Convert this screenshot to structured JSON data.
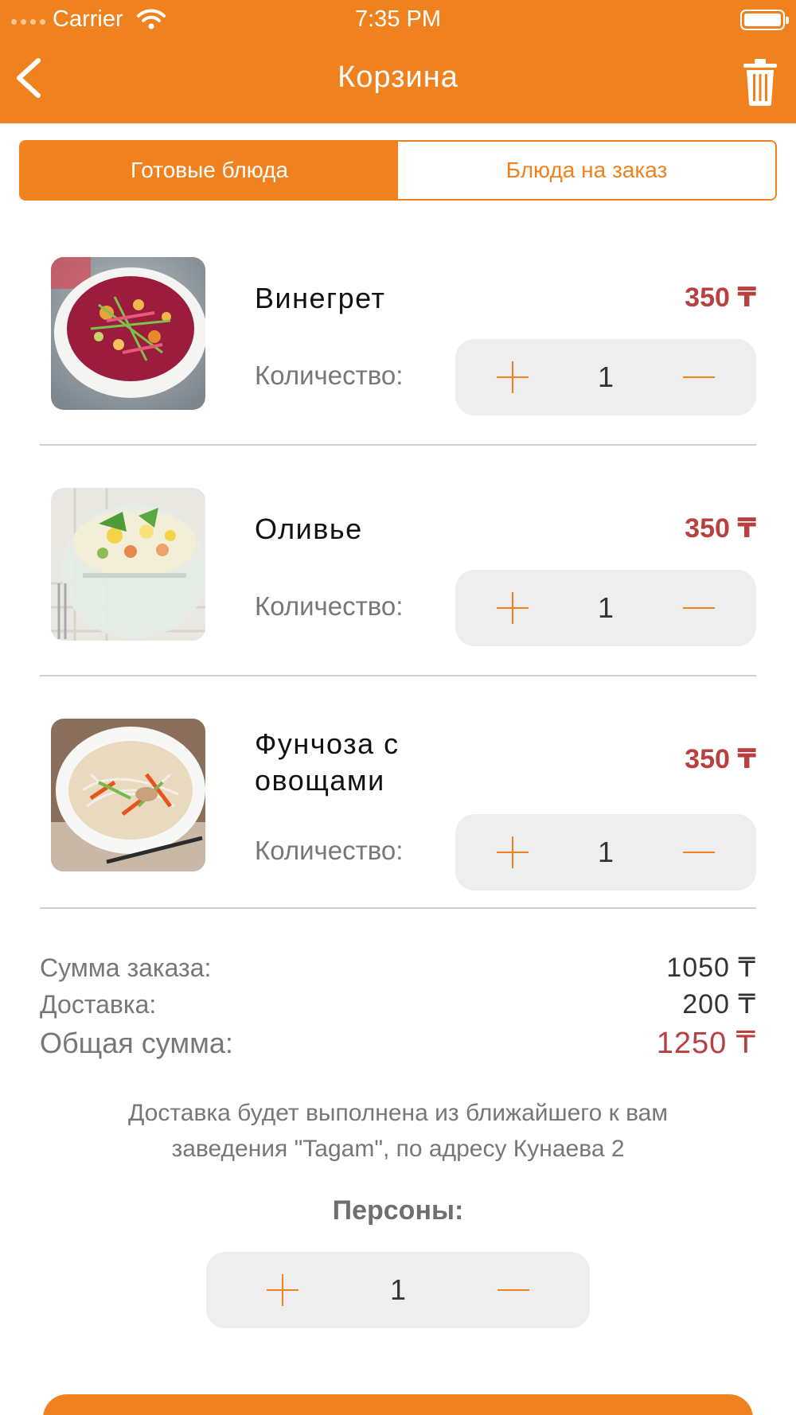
{
  "status_bar": {
    "carrier": "Carrier",
    "time": "7:35 PM"
  },
  "nav": {
    "title": "Корзина",
    "back_icon": "chevron-left-icon",
    "trash_icon": "trash-icon"
  },
  "segments": {
    "tabs": [
      {
        "label": "Готовые блюда",
        "selected": true
      },
      {
        "label": "Блюда на заказ",
        "selected": false
      }
    ]
  },
  "cart": {
    "quantity_label": "Количество:",
    "items": [
      {
        "name": "Винегрет",
        "price": "350 ₸",
        "quantity": "1"
      },
      {
        "name": "Оливье",
        "price": "350 ₸",
        "quantity": "1"
      },
      {
        "name": "Фунчоза с овощами",
        "price": "350 ₸",
        "quantity": "1"
      }
    ]
  },
  "summary": {
    "subtotal_label": "Сумма заказа:",
    "subtotal_value": "1050 ₸",
    "delivery_label": "Доставка:",
    "delivery_value": "200 ₸",
    "total_label": "Общая сумма:",
    "total_value": "1250 ₸"
  },
  "delivery_note": "Доставка будет выполнена из ближайшего к вам заведения \"Tagam\", по адресу Кунаева 2",
  "persons": {
    "label": "Персоны:",
    "count": "1"
  },
  "colors": {
    "accent": "#EF821E",
    "price": "#B8413F",
    "stepper_bg": "#EEEEEE",
    "muted_text": "#777777"
  }
}
